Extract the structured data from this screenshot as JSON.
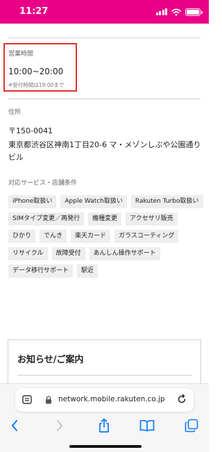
{
  "status_bar": {
    "time": "11:27",
    "background": "#ea0087"
  },
  "shop": {
    "hours": {
      "label": "営業時間",
      "value": "10:00~20:00",
      "note": "※受付時間は19:00まで",
      "highlight_color": "#e0332b"
    },
    "address": {
      "label": "住所",
      "postal": "〒150-0041",
      "text": "東京都渋谷区神南1丁目20-6 マ・メゾンしぶや公園通りビル"
    },
    "services": {
      "label": "対応サービス・店舗条件",
      "tags": [
        "iPhone取扱い",
        "Apple Watch取扱い",
        "Rakuten Turbo取扱い",
        "SIMタイプ変更／再発行",
        "機種変更",
        "アクセサリ販売",
        "ひかり",
        "でんき",
        "楽天カード",
        "ガラスコーティング",
        "リサイクル",
        "故障受付",
        "あんしん操作サポート",
        "データ移行サポート",
        "駅近"
      ]
    }
  },
  "news": {
    "title": "お知らせ/ご案内"
  },
  "browser": {
    "url": "network.mobile.rakuten.co.jp",
    "icons": [
      "reader-icon",
      "lock-icon",
      "reload-icon",
      "back-icon",
      "forward-icon",
      "share-icon",
      "bookmarks-icon",
      "tabs-icon"
    ],
    "accent": "#0a7aff"
  }
}
